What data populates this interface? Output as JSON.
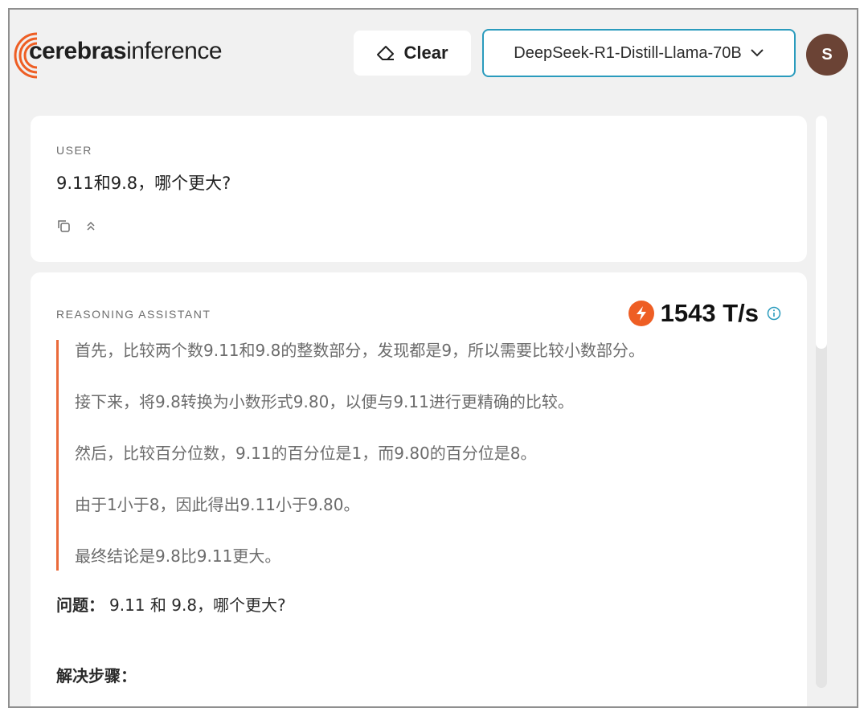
{
  "header": {
    "brand_bold": "cerebras",
    "brand_light": "inference",
    "clear_label": "Clear",
    "model_label": "DeepSeek-R1-Distill-Llama-70B",
    "avatar_initial": "S"
  },
  "colors": {
    "accent": "#ee5e24",
    "select_border": "#2a9bbd",
    "avatar_bg": "#6b4335"
  },
  "user_card": {
    "role": "USER",
    "message": "9.11和9.8，哪个更大?"
  },
  "assistant_card": {
    "role": "REASONING ASSISTANT",
    "speed": "1543 T/s",
    "reasoning": [
      "首先，比较两个数9.11和9.8的整数部分，发现都是9，所以需要比较小数部分。",
      "接下来，将9.8转换为小数形式9.80，以便与9.11进行更精确的比较。",
      "然后，比较百分位数，9.11的百分位是1，而9.80的百分位是8。",
      "由于1小于8，因此得出9.11小于9.80。",
      "最终结论是9.8比9.11更大。"
    ],
    "question_label": "问题：",
    "question_text": "9.11 和 9.8，哪个更大?",
    "steps_label": "解决步骤："
  },
  "icons": {
    "clear": "eraser-icon",
    "model": "chevron-down-icon",
    "copy": "copy-icon",
    "collapse": "chevrons-up-icon",
    "speed": "lightning-bolt-icon",
    "info": "info-circle-icon"
  }
}
